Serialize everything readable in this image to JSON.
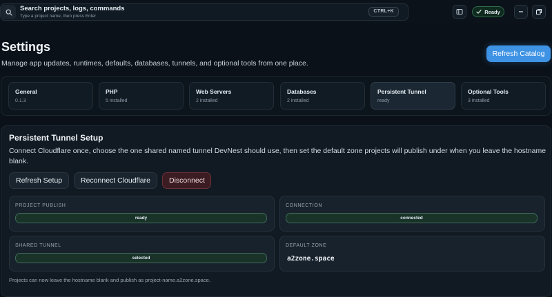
{
  "topbar": {
    "search_title": "Search projects, logs, commands",
    "search_hint": "Type a project name, then press Enter",
    "shortcut": "CTRL+K",
    "status": "Ready",
    "icons": [
      "search-icon",
      "sidebar-toggle-icon",
      "check-icon",
      "minimize-icon",
      "restore-window-icon"
    ]
  },
  "header": {
    "title": "Settings",
    "subtitle": "Manage app updates, runtimes, defaults, databases, tunnels, and optional tools from one place.",
    "refresh_catalog": "Refresh Catalog"
  },
  "tabs": [
    {
      "label": "General",
      "sub": "0.1.3"
    },
    {
      "label": "PHP",
      "sub": "5 installed"
    },
    {
      "label": "Web Servers",
      "sub": "2 installed"
    },
    {
      "label": "Databases",
      "sub": "2 installed"
    },
    {
      "label": "Persistent Tunnel",
      "sub": "ready",
      "active": true
    },
    {
      "label": "Optional Tools",
      "sub": "3 installed"
    }
  ],
  "tunnel": {
    "title": "Persistent Tunnel Setup",
    "description": "Connect Cloudflare once, choose the one shared named tunnel DevNest should use, then set the default zone projects will publish under when you leave the hostname blank.",
    "buttons": {
      "refresh": "Refresh Setup",
      "reconnect": "Reconnect Cloudflare",
      "disconnect": "Disconnect"
    },
    "cards": {
      "project_publish": {
        "label": "PROJECT PUBLISH",
        "value": "ready"
      },
      "connection": {
        "label": "CONNECTION",
        "value": "connected"
      },
      "shared_tunnel": {
        "label": "SHARED TUNNEL",
        "value": "selected"
      },
      "default_zone": {
        "label": "DEFAULT ZONE",
        "value": "a2zone.space"
      }
    },
    "footnote": "Projects can now leave the hostname blank and publish as project-name.a2zone.space."
  },
  "colors": {
    "accent": "#3f93e4",
    "success": "#2f6b4c",
    "danger": "#6e2f38",
    "background": "#0a1118"
  }
}
